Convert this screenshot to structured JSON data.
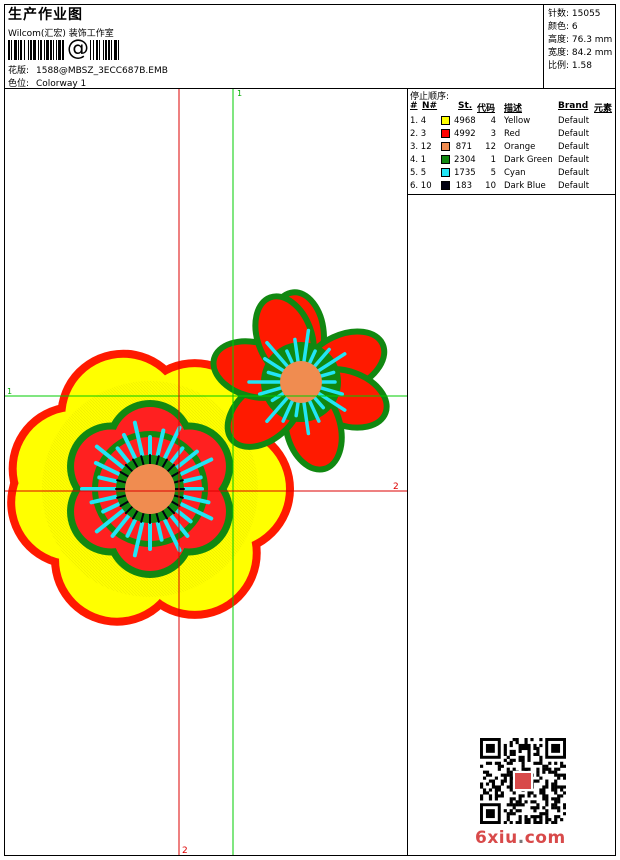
{
  "header": {
    "title": "生产作业图",
    "subtitle": "Wilcom(汇宏) 装饰工作室",
    "barcode_symbol": "@",
    "design_label": "花版:",
    "design_value": "1588@MBSZ_3ECC687B.EMB",
    "colorway_label": "色位:",
    "colorway_value": "Colorway 1"
  },
  "stats": {
    "stitches": "针数: 15055",
    "colors": "颜色: 6",
    "height": "高度: 76.3 mm",
    "width": "宽度: 84.2 mm",
    "ratio": "比例: 1.58"
  },
  "guides": {
    "green_v": "1",
    "green_h": "1",
    "red_h": "2",
    "red_v": "2"
  },
  "color_table": {
    "title": "停止顺序:",
    "headers": {
      "hash": "#",
      "n": "N#",
      "st": "St.",
      "code": "代码",
      "desc": "描述",
      "brand": "Brand",
      "elem": "元素"
    },
    "rows": [
      {
        "seq": "1. 4",
        "stitches": "4968",
        "code": "4",
        "desc": "Yellow",
        "brand": "Default",
        "color": "#ffff00"
      },
      {
        "seq": "2. 3",
        "stitches": "4992",
        "code": "3",
        "desc": "Red",
        "brand": "Default",
        "color": "#ff0000"
      },
      {
        "seq": "3. 12",
        "stitches": "871",
        "code": "12",
        "desc": "Orange",
        "brand": "Default",
        "color": "#f08c50"
      },
      {
        "seq": "4. 1",
        "stitches": "2304",
        "code": "1",
        "desc": "Dark Green",
        "brand": "Default",
        "color": "#118811"
      },
      {
        "seq": "5. 5",
        "stitches": "1735",
        "code": "5",
        "desc": "Cyan",
        "brand": "Default",
        "color": "#22e5f5"
      },
      {
        "seq": "6. 10",
        "stitches": "183",
        "code": "10",
        "desc": "Dark Blue",
        "brand": "Default",
        "color": "#000010"
      }
    ]
  },
  "watermark": {
    "part1": "6xiu",
    "dot": ".",
    "part2": "com"
  }
}
